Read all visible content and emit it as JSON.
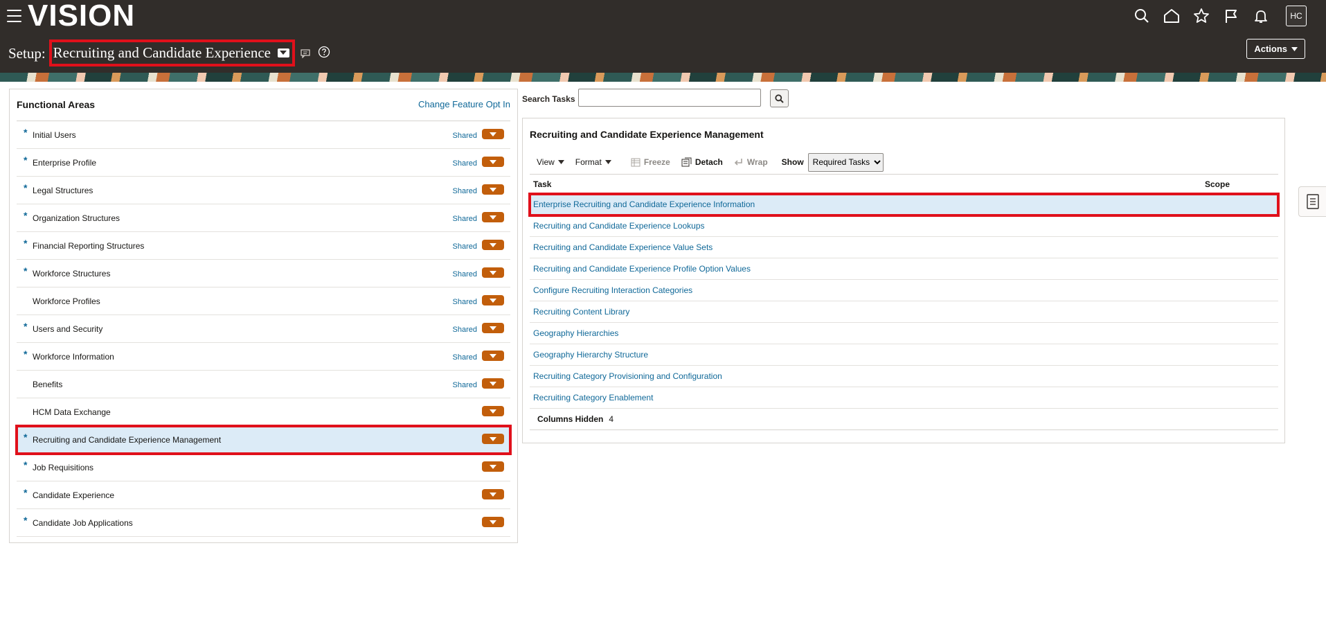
{
  "app": {
    "logo": "VISION",
    "avatar": "HC",
    "top_icons": [
      "search-icon",
      "home-icon",
      "favorites-star-icon",
      "flag-icon",
      "notifications-bell-icon"
    ]
  },
  "header": {
    "prefix": "Setup:",
    "offering": "Recruiting and Candidate Experience",
    "actions_label": "Actions"
  },
  "functional_areas": {
    "title": "Functional Areas",
    "link": "Change Feature Opt In",
    "items": [
      {
        "label": "Initial Users",
        "required": true,
        "shared": "Shared"
      },
      {
        "label": "Enterprise Profile",
        "required": true,
        "shared": "Shared"
      },
      {
        "label": "Legal Structures",
        "required": true,
        "shared": "Shared"
      },
      {
        "label": "Organization Structures",
        "required": true,
        "shared": "Shared"
      },
      {
        "label": "Financial Reporting Structures",
        "required": true,
        "shared": "Shared"
      },
      {
        "label": "Workforce Structures",
        "required": true,
        "shared": "Shared"
      },
      {
        "label": "Workforce Profiles",
        "required": false,
        "shared": "Shared"
      },
      {
        "label": "Users and Security",
        "required": true,
        "shared": "Shared"
      },
      {
        "label": "Workforce Information",
        "required": true,
        "shared": "Shared"
      },
      {
        "label": "Benefits",
        "required": false,
        "shared": "Shared"
      },
      {
        "label": "HCM Data Exchange",
        "required": false,
        "shared": ""
      },
      {
        "label": "Recruiting and Candidate Experience Management",
        "required": true,
        "shared": "",
        "selected": true
      },
      {
        "label": "Job Requisitions",
        "required": true,
        "shared": ""
      },
      {
        "label": "Candidate Experience",
        "required": true,
        "shared": ""
      },
      {
        "label": "Candidate Job Applications",
        "required": true,
        "shared": ""
      }
    ]
  },
  "search": {
    "label": "Search Tasks",
    "value": ""
  },
  "task_panel": {
    "title": "Recruiting and Candidate Experience Management",
    "toolbar": {
      "view": "View",
      "format": "Format",
      "freeze": "Freeze",
      "detach": "Detach",
      "wrap": "Wrap",
      "show_label": "Show",
      "show_value": "Required Tasks"
    },
    "columns": {
      "task": "Task",
      "scope": "Scope"
    },
    "tasks": [
      {
        "label": "Enterprise Recruiting and Candidate Experience Information",
        "selected": true
      },
      {
        "label": "Recruiting and Candidate Experience Lookups"
      },
      {
        "label": "Recruiting and Candidate Experience Value Sets"
      },
      {
        "label": "Recruiting and Candidate Experience Profile Option Values"
      },
      {
        "label": "Configure Recruiting Interaction Categories"
      },
      {
        "label": "Recruiting Content Library"
      },
      {
        "label": "Geography Hierarchies"
      },
      {
        "label": "Geography Hierarchy Structure"
      },
      {
        "label": "Recruiting Category Provisioning and Configuration"
      },
      {
        "label": "Recruiting Category Enablement"
      }
    ],
    "columns_hidden_label": "Columns Hidden",
    "columns_hidden_count": "4"
  }
}
